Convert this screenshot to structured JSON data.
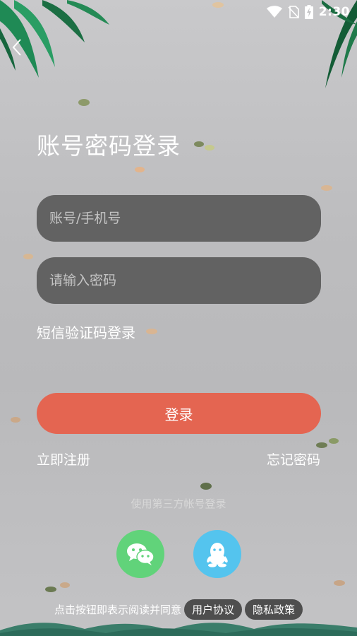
{
  "status_bar": {
    "time": "2:30"
  },
  "title": "账号密码登录",
  "account_field": {
    "placeholder": "账号/手机号",
    "value": ""
  },
  "password_field": {
    "placeholder": "请输入密码",
    "value": ""
  },
  "sms_login_label": "短信验证码登录",
  "login_button_label": "登录",
  "register_label": "立即注册",
  "forgot_label": "忘记密码",
  "third_party_label": "使用第三方帐号登录",
  "social": {
    "wechat_icon": "wechat-icon",
    "qq_icon": "qq-icon"
  },
  "agreement": {
    "prefix": "点击按钮即表示阅读并同意",
    "user_agreement": "用户协议",
    "privacy_policy": "隐私政策"
  },
  "colors": {
    "login_button": "#e46551",
    "field_bg": "#626262",
    "wechat": "#61d37a",
    "qq": "#54c4ee",
    "leaf": "#1f7a4a"
  }
}
